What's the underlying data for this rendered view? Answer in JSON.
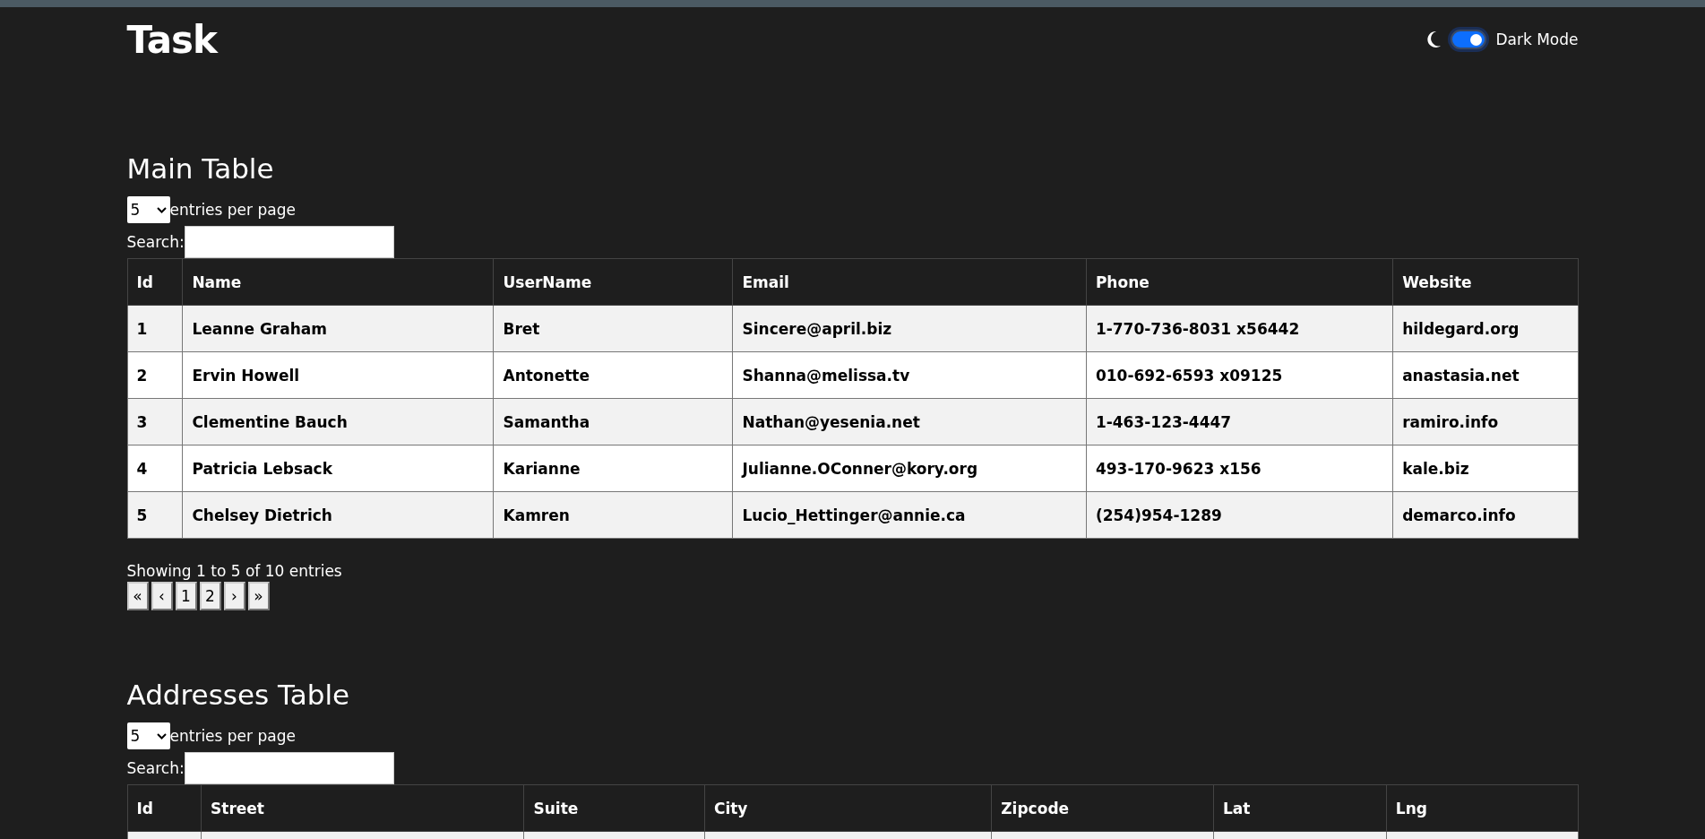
{
  "header": {
    "title": "Task",
    "dark_mode": {
      "label": "Dark Mode",
      "on": true
    }
  },
  "tables": [
    {
      "title": "Main Table",
      "page_size": "5",
      "page_size_label": "entries per page",
      "search_label": "Search:",
      "columns": [
        "Id",
        "Name",
        "UserName",
        "Email",
        "Phone",
        "Website"
      ],
      "rows": [
        [
          "1",
          "Leanne Graham",
          "Bret",
          "Sincere@april.biz",
          "1-770-736-8031 x56442",
          "hildegard.org"
        ],
        [
          "2",
          "Ervin Howell",
          "Antonette",
          "Shanna@melissa.tv",
          "010-692-6593 x09125",
          "anastasia.net"
        ],
        [
          "3",
          "Clementine Bauch",
          "Samantha",
          "Nathan@yesenia.net",
          "1-463-123-4447",
          "ramiro.info"
        ],
        [
          "4",
          "Patricia Lebsack",
          "Karianne",
          "Julianne.OConner@kory.org",
          "493-170-9623 x156",
          "kale.biz"
        ],
        [
          "5",
          "Chelsey Dietrich",
          "Kamren",
          "Lucio_Hettinger@annie.ca",
          "(254)954-1289",
          "demarco.info"
        ]
      ],
      "info": "Showing 1 to 5 of 10 entries",
      "pagination": [
        "«",
        "‹",
        "1",
        "2",
        "›",
        "»"
      ]
    },
    {
      "title": "Addresses Table",
      "page_size": "5",
      "page_size_label": "entries per page",
      "search_label": "Search:",
      "columns": [
        "Id",
        "Street",
        "Suite",
        "City",
        "Zipcode",
        "Lat",
        "Lng"
      ]
    }
  ]
}
